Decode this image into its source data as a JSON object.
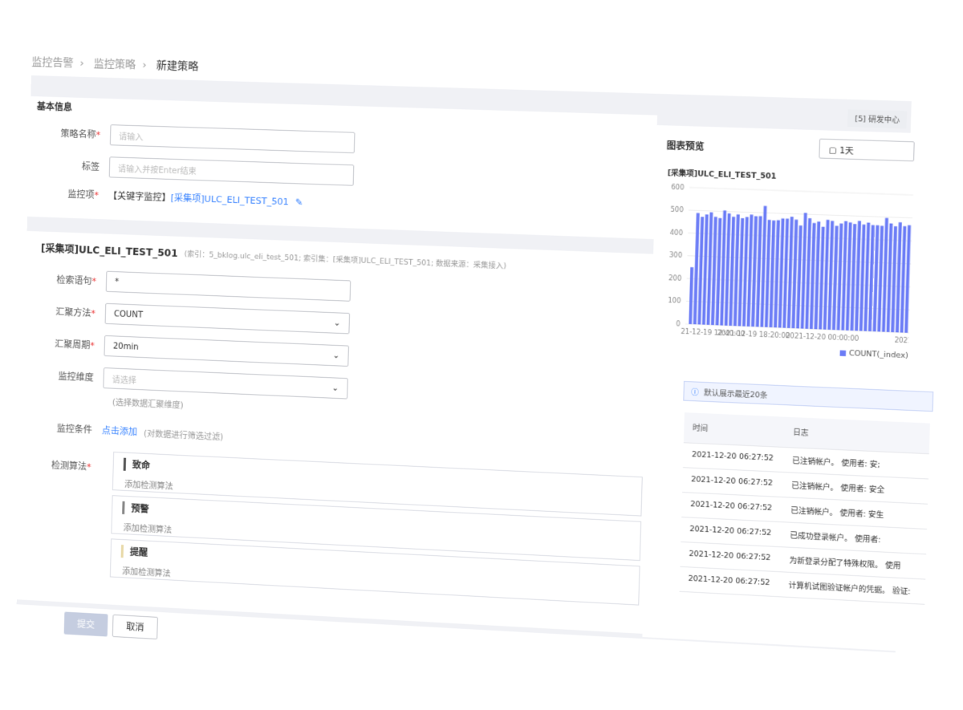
{
  "breadcrumb": [
    "监控告警",
    "监控策略",
    "新建策略"
  ],
  "space_tag": "[5] 研发中心",
  "basic": {
    "title": "基本信息",
    "name_label": "策略名称",
    "name_placeholder": "请输入",
    "tags_label": "标签",
    "tags_placeholder": "请输入并按Enter结束",
    "item_label": "监控项",
    "item_prefix": "【关键字监控】",
    "item_link": "[采集项]ULC_ELI_TEST_501"
  },
  "query": {
    "title": "[采集项]ULC_ELI_TEST_501",
    "meta": "(索引：5_bklog.ulc_eli_test_501; 索引集：[采集项]ULC_ELI_TEST_501; 数据来源：采集接入)",
    "stmt_label": "检索语句",
    "stmt_value": "*",
    "agg_label": "汇聚方法",
    "agg_value": "COUNT",
    "period_label": "汇聚周期",
    "period_value": "20min",
    "dim_label": "监控维度",
    "dim_placeholder": "请选择",
    "dim_hint": "(选择数据汇聚维度)",
    "cond_label": "监控条件",
    "cond_link": "点击添加",
    "cond_hint": "(对数据进行筛选过滤)",
    "algo_label": "检测算法",
    "levels": [
      {
        "name": "致命",
        "add": "添加检测算法",
        "color": "#ea3636"
      },
      {
        "name": "预警",
        "add": "添加检测算法",
        "color": "#ff9c01"
      },
      {
        "name": "提醒",
        "add": "添加检测算法",
        "color": "#ffd695"
      }
    ]
  },
  "actions": {
    "submit": "提交",
    "cancel": "取消"
  },
  "preview": {
    "title": "图表预览",
    "range": "1天",
    "notice": "默认展示最近20条",
    "table": {
      "headers": [
        "时间",
        "日志"
      ],
      "rows": [
        [
          "2021-12-20 06:27:52",
          "已注销帐户。 使用者: 安;"
        ],
        [
          "2021-12-20 06:27:52",
          "已注销帐户。 使用者: 安全"
        ],
        [
          "2021-12-20 06:27:52",
          "已注销帐户。 使用者: 安生"
        ],
        [
          "2021-12-20 06:27:52",
          "已成功登录帐户。 使用者:"
        ],
        [
          "2021-12-20 06:27:52",
          "为新登录分配了特殊权限。 使用"
        ],
        [
          "2021-12-20 06:27:52",
          "计算机试图验证帐户的凭据。 验证:"
        ]
      ]
    }
  },
  "chart_data": {
    "type": "bar",
    "title": "[采集项]ULC_ELI_TEST_501",
    "ylim": [
      0,
      600
    ],
    "yticks": [
      0,
      100,
      200,
      300,
      400,
      500,
      600
    ],
    "xtick_labels": [
      "21-12-19 12:40:00",
      "2021-12-19 18:20:00",
      "2021-12-20 00:00:00",
      "2021-"
    ],
    "color": "#6b7cf6",
    "grid": true,
    "legend": "bottom",
    "series": [
      {
        "name": "COUNT(_index)",
        "values": [
          250,
          489,
          473,
          484,
          494,
          475,
          470,
          504,
          492,
          478,
          489,
          473,
          479,
          490,
          484,
          485,
          530,
          470,
          468,
          470,
          478,
          478,
          487,
          475,
          450,
          506,
          483,
          463,
          470,
          448,
          479,
          475,
          454,
          465,
          476,
          471,
          465,
          479,
          464,
          473,
          463,
          463,
          461,
          496,
          473,
          461,
          479,
          463,
          468
        ]
      }
    ]
  }
}
